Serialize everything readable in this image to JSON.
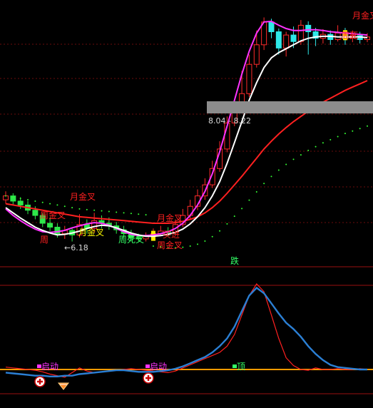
{
  "chart_data": [
    {
      "type": "candlestick",
      "panel": "main",
      "background": "#000000",
      "gridlines": "dashed dark red, horizontal",
      "price_range_label": "8.04 - 8.22",
      "low_marker_label": "←6.18",
      "bar_count": 50,
      "candles": [
        [
          6.82,
          6.88,
          6.95,
          6.76
        ],
        [
          6.88,
          6.8,
          6.92,
          6.74
        ],
        [
          6.8,
          6.74,
          6.86,
          6.68
        ],
        [
          6.74,
          6.66,
          6.8,
          6.6
        ],
        [
          6.66,
          6.58,
          6.72,
          6.52
        ],
        [
          6.58,
          6.46,
          6.62,
          6.4
        ],
        [
          6.46,
          6.4,
          6.55,
          6.34
        ],
        [
          6.4,
          6.3,
          6.46,
          6.24
        ],
        [
          6.3,
          6.35,
          6.42,
          6.22
        ],
        [
          6.35,
          6.28,
          6.4,
          6.18
        ],
        [
          6.28,
          6.44,
          6.6,
          6.24
        ],
        [
          6.44,
          6.38,
          6.52,
          6.3
        ],
        [
          6.38,
          6.5,
          6.62,
          6.32
        ],
        [
          6.5,
          6.46,
          6.58,
          6.38
        ],
        [
          6.46,
          6.42,
          6.55,
          6.36
        ],
        [
          6.42,
          6.36,
          6.48,
          6.3
        ],
        [
          6.36,
          6.3,
          6.42,
          6.24
        ],
        [
          6.3,
          6.24,
          6.36,
          6.18
        ],
        [
          6.24,
          6.22,
          6.3,
          6.18
        ],
        [
          6.22,
          6.26,
          6.32,
          6.18
        ],
        [
          6.26,
          6.3,
          6.38,
          6.22
        ],
        [
          6.3,
          6.34,
          6.42,
          6.26
        ],
        [
          6.34,
          6.32,
          6.4,
          6.26
        ],
        [
          6.32,
          6.44,
          6.52,
          6.28
        ],
        [
          6.44,
          6.58,
          6.68,
          6.4
        ],
        [
          6.58,
          6.72,
          6.82,
          6.52
        ],
        [
          6.72,
          6.88,
          6.98,
          6.66
        ],
        [
          6.88,
          7.05,
          7.15,
          6.82
        ],
        [
          7.05,
          7.3,
          7.42,
          7.0
        ],
        [
          7.3,
          7.6,
          7.72,
          7.25
        ],
        [
          7.6,
          8.0,
          8.1,
          7.55
        ],
        [
          8.0,
          8.25,
          8.35,
          7.95
        ],
        [
          8.25,
          8.45,
          8.8,
          8.2
        ],
        [
          8.45,
          8.9,
          9.05,
          8.4
        ],
        [
          8.9,
          9.2,
          9.42,
          8.85
        ],
        [
          9.2,
          9.55,
          9.62,
          9.12
        ],
        [
          9.55,
          9.4,
          9.6,
          9.3
        ],
        [
          9.4,
          9.15,
          9.45,
          9.05
        ],
        [
          9.15,
          9.35,
          9.4,
          9.02
        ],
        [
          9.35,
          9.25,
          9.48,
          9.15
        ],
        [
          9.25,
          9.5,
          9.58,
          9.2
        ],
        [
          9.5,
          9.4,
          9.56,
          9.05
        ],
        [
          9.4,
          9.3,
          9.46,
          9.18
        ],
        [
          9.3,
          9.36,
          9.44,
          9.22
        ],
        [
          9.36,
          9.28,
          9.42,
          9.2
        ],
        [
          9.28,
          9.38,
          9.5,
          9.25
        ],
        [
          9.38,
          9.3,
          9.46,
          9.2
        ],
        [
          9.3,
          9.34,
          9.42,
          9.24
        ],
        [
          9.34,
          9.28,
          9.4,
          9.22
        ],
        [
          9.28,
          9.32,
          9.38,
          9.24
        ]
      ],
      "lines": [
        {
          "color": "#ffffff",
          "values": [
            6.7,
            6.62,
            6.54,
            6.47,
            6.4,
            6.35,
            6.31,
            6.28,
            6.29,
            6.31,
            6.34,
            6.38,
            6.41,
            6.43,
            6.42,
            6.39,
            6.35,
            6.31,
            6.28,
            6.26,
            6.26,
            6.27,
            6.29,
            6.32,
            6.37,
            6.45,
            6.56,
            6.7,
            6.88,
            7.1,
            7.38,
            7.7,
            8.02,
            8.35,
            8.62,
            8.85,
            9.0,
            9.08,
            9.14,
            9.2,
            9.26,
            9.3,
            9.32,
            9.33,
            9.33,
            9.32,
            9.32,
            9.32,
            9.32,
            9.31
          ]
        },
        {
          "color": "#ff33ff",
          "values": [
            6.68,
            6.58,
            6.5,
            6.43,
            6.37,
            6.33,
            6.32,
            6.33,
            6.35,
            6.39,
            6.42,
            6.45,
            6.47,
            6.46,
            6.43,
            6.38,
            6.33,
            6.29,
            6.27,
            6.27,
            6.28,
            6.3,
            6.33,
            6.38,
            6.46,
            6.58,
            6.74,
            6.95,
            7.22,
            7.56,
            7.95,
            8.35,
            8.75,
            9.1,
            9.38,
            9.55,
            9.56,
            9.5,
            9.45,
            9.42,
            9.42,
            9.43,
            9.43,
            9.42,
            9.4,
            9.39,
            9.38,
            9.37,
            9.36,
            9.35
          ]
        },
        {
          "color": "#ff2020",
          "values": [
            6.76,
            6.74,
            6.72,
            6.7,
            6.68,
            6.66,
            6.64,
            6.62,
            6.6,
            6.58,
            6.56,
            6.55,
            6.54,
            6.53,
            6.52,
            6.51,
            6.5,
            6.49,
            6.48,
            6.47,
            6.46,
            6.46,
            6.46,
            6.47,
            6.49,
            6.52,
            6.56,
            6.62,
            6.7,
            6.8,
            6.92,
            7.05,
            7.18,
            7.32,
            7.46,
            7.6,
            7.72,
            7.83,
            7.93,
            8.02,
            8.1,
            8.18,
            8.25,
            8.32,
            8.38,
            8.44,
            8.5,
            8.55,
            8.6,
            8.65
          ]
        }
      ],
      "annotations": [
        {
          "text": "月金叉",
          "color": "#ff2020"
        },
        {
          "text": "周金叉",
          "color": "#ff2020"
        },
        {
          "text": "月金叉",
          "color": "#ffff00"
        },
        {
          "text": "周死叉",
          "color": "#33ff66"
        },
        {
          "text": "周",
          "color": "#ff2020"
        },
        {
          "text": "月金叉",
          "color": "#ff2020"
        },
        {
          "text": "买进",
          "color": "#ff2020"
        },
        {
          "text": "周金叉",
          "color": "#ff2020"
        },
        {
          "text": "月金叉",
          "color": "#ff2020"
        },
        {
          "text": "周死",
          "color": "#ff2020"
        }
      ]
    },
    {
      "type": "line",
      "panel": "indicator",
      "top_label": "跌",
      "orange_level": 0,
      "series": [
        {
          "color": "#ff2020",
          "values": [
            3,
            2,
            1,
            0,
            -1,
            -3,
            -6,
            -8,
            -10,
            -4,
            2,
            -2,
            -4,
            -3,
            -2,
            -1,
            0,
            1,
            0,
            -1,
            -2,
            -3,
            -4,
            -2,
            2,
            6,
            10,
            14,
            18,
            22,
            30,
            45,
            70,
            95,
            110,
            100,
            70,
            40,
            15,
            5,
            0,
            -1,
            2,
            0,
            0,
            1,
            0,
            0,
            1,
            0
          ]
        },
        {
          "color": "#2b7fd4",
          "values": [
            -4,
            -5,
            -6,
            -7,
            -8,
            -8,
            -9,
            -9,
            -8,
            -8,
            -6,
            -5,
            -4,
            -3,
            -2,
            -1,
            -1,
            -2,
            -3,
            -3,
            -3,
            -2,
            -1,
            1,
            4,
            8,
            12,
            16,
            22,
            30,
            40,
            55,
            75,
            95,
            105,
            98,
            85,
            72,
            60,
            52,
            42,
            30,
            20,
            12,
            6,
            3,
            2,
            1,
            0,
            0
          ]
        }
      ],
      "annotations": [
        {
          "text": "启动",
          "color": "#ff33ff"
        },
        {
          "text": "启动",
          "color": "#ff33ff"
        },
        {
          "text": "顶",
          "color": "#33ff66"
        }
      ]
    }
  ]
}
